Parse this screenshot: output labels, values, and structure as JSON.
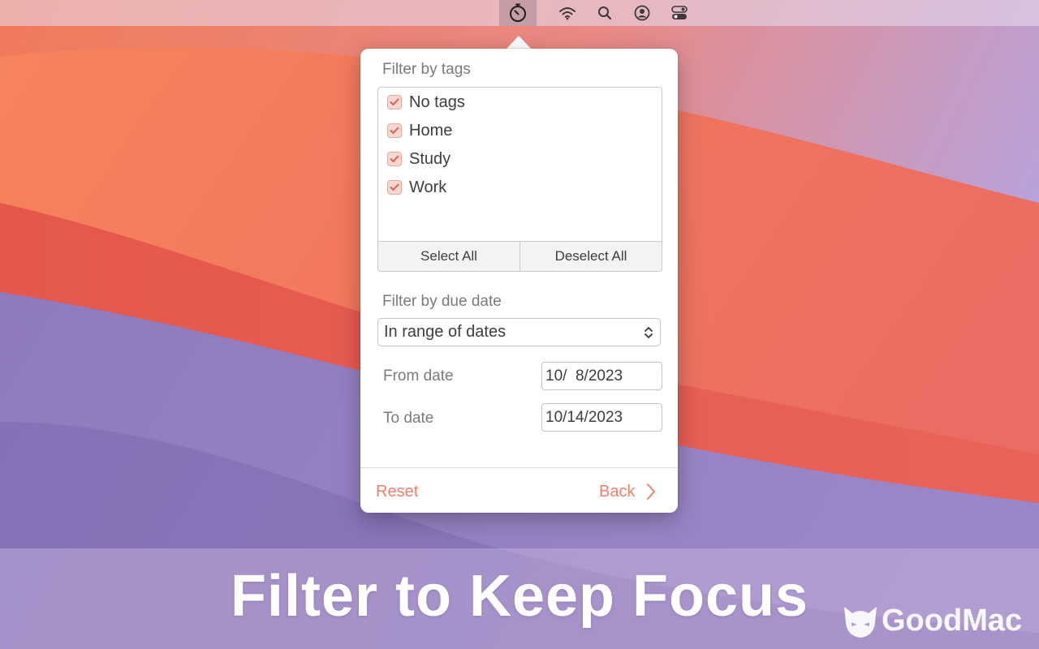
{
  "menubar": {
    "icons": [
      "timer-icon",
      "wifi-icon",
      "search-icon",
      "user-icon",
      "control-center-icon"
    ]
  },
  "popover": {
    "tags_section_title": "Filter by tags",
    "tags": [
      {
        "label": "No tags",
        "checked": true
      },
      {
        "label": "Home",
        "checked": true
      },
      {
        "label": "Study",
        "checked": true
      },
      {
        "label": "Work",
        "checked": true
      }
    ],
    "select_all_label": "Select All",
    "deselect_all_label": "Deselect All",
    "due_date_section_title": "Filter by due date",
    "due_date_mode": "In range of dates",
    "from_date_label": "From date",
    "from_date_value": "10/  8/2023",
    "to_date_label": "To date",
    "to_date_value": "10/14/2023",
    "reset_label": "Reset",
    "back_label": "Back"
  },
  "banner": {
    "title": "Filter to Keep Focus",
    "watermark": "GoodMac"
  },
  "colors": {
    "accent": "#ef7f6b",
    "checkbox_fill": "#f6d7d2",
    "text": "#3d3d3d",
    "secondary_text": "#7a7a7a"
  }
}
